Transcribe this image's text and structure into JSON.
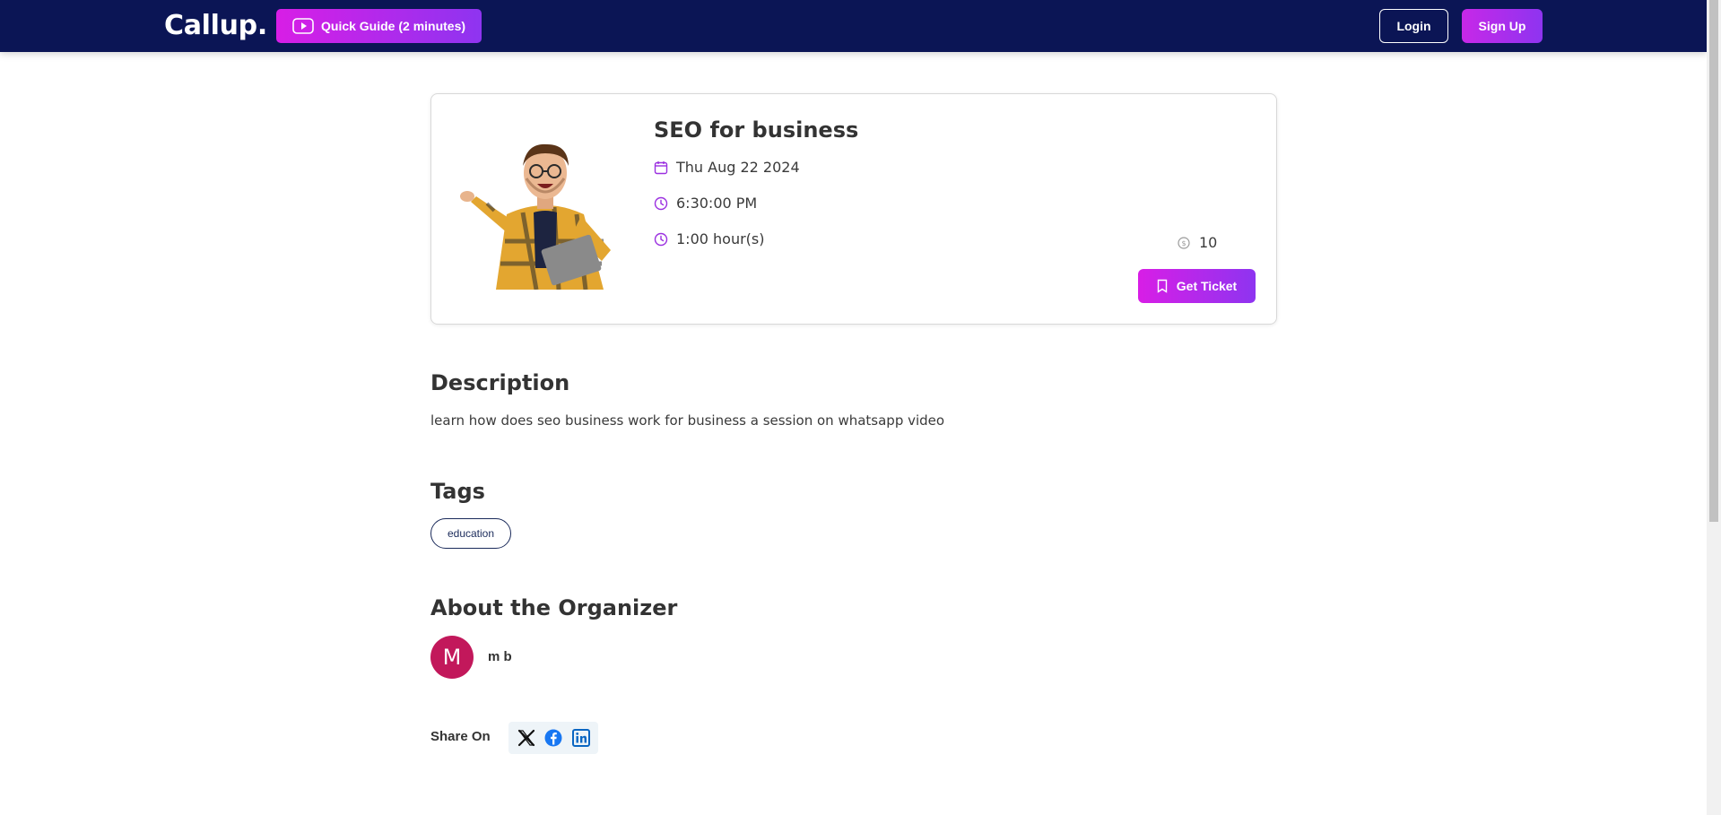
{
  "header": {
    "brand": "Callup.",
    "guide_label": "Quick Guide (2 minutes)",
    "login_label": "Login",
    "signup_label": "Sign Up"
  },
  "event": {
    "title": "SEO for business",
    "date": "Thu Aug 22 2024",
    "time": "6:30:00 PM",
    "duration": "1:00 hour(s)",
    "price": "10",
    "ticket_label": "Get Ticket"
  },
  "description": {
    "heading": "Description",
    "text": "learn how does seo business work for business a session on whatsapp video"
  },
  "tags": {
    "heading": "Tags",
    "items": [
      "education"
    ]
  },
  "organizer": {
    "heading": "About the Organizer",
    "initial": "M",
    "name": "m b"
  },
  "share": {
    "label": "Share On",
    "icons": [
      "x-icon",
      "facebook-icon",
      "linkedin-icon"
    ]
  },
  "colors": {
    "header_bg": "#0b1555",
    "accent_start": "#d81ee6",
    "accent_end": "#8e34f0",
    "icon_purple": "#9b30e0",
    "avatar_bg": "#c2185b",
    "tag_border": "#1a2a5a"
  }
}
